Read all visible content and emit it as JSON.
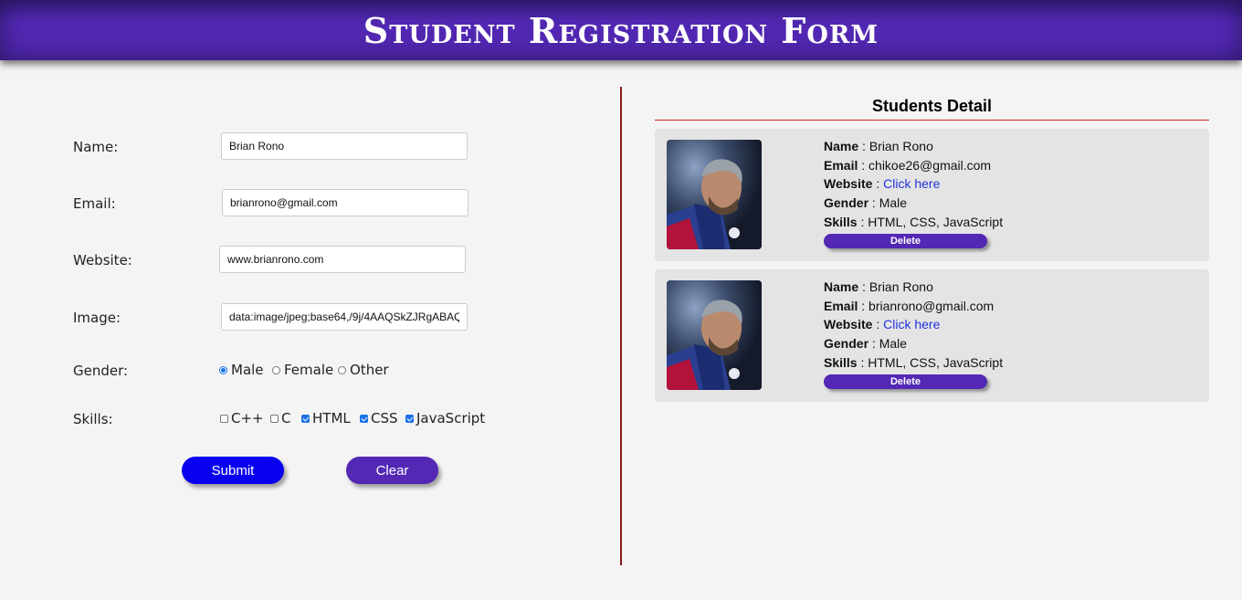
{
  "header": {
    "title": "Student Registration Form"
  },
  "form": {
    "name_label": "Name:",
    "name_value": "Brian Rono",
    "email_label": "Email:",
    "email_value": "brianrono@gmail.com",
    "website_label": "Website:",
    "website_value": "www.brianrono.com",
    "image_label": "Image:",
    "image_value": "data:image/jpeg;base64,/9j/4AAQSkZJRgABAQ",
    "gender_label": "Gender:",
    "gender_options": [
      "Male",
      "Female",
      "Other"
    ],
    "gender_selected": "Male",
    "skills_label": "Skills:",
    "skills_options": [
      "C++",
      "C",
      "HTML",
      "CSS",
      "JavaScript"
    ],
    "skills_checked": [
      "HTML",
      "CSS",
      "JavaScript"
    ],
    "submit_label": "Submit",
    "clear_label": "Clear"
  },
  "details": {
    "title": "Students Detail",
    "students": [
      {
        "name_key": "Name",
        "name": "Brian Rono",
        "email_key": "Email",
        "email": "chikoe26@gmail.com",
        "website_key": "Website",
        "website_link": "Click here",
        "gender_key": "Gender",
        "gender": "Male",
        "skills_key": "Skills",
        "skills": "HTML, CSS, JavaScript",
        "delete_label": "Delete"
      },
      {
        "name_key": "Name",
        "name": "Brian Rono",
        "email_key": "Email",
        "email": "brianrono@gmail.com",
        "website_key": "Website",
        "website_link": "Click here",
        "gender_key": "Gender",
        "gender": "Male",
        "skills_key": "Skills",
        "skills": "HTML, CSS, JavaScript",
        "delete_label": "Delete"
      }
    ]
  },
  "colors": {
    "header_bg": "#5228b4",
    "submit_bg": "#0a00f0",
    "clear_bg": "#5228b4",
    "divider": "#8b1a1a",
    "link": "#2233dd"
  }
}
